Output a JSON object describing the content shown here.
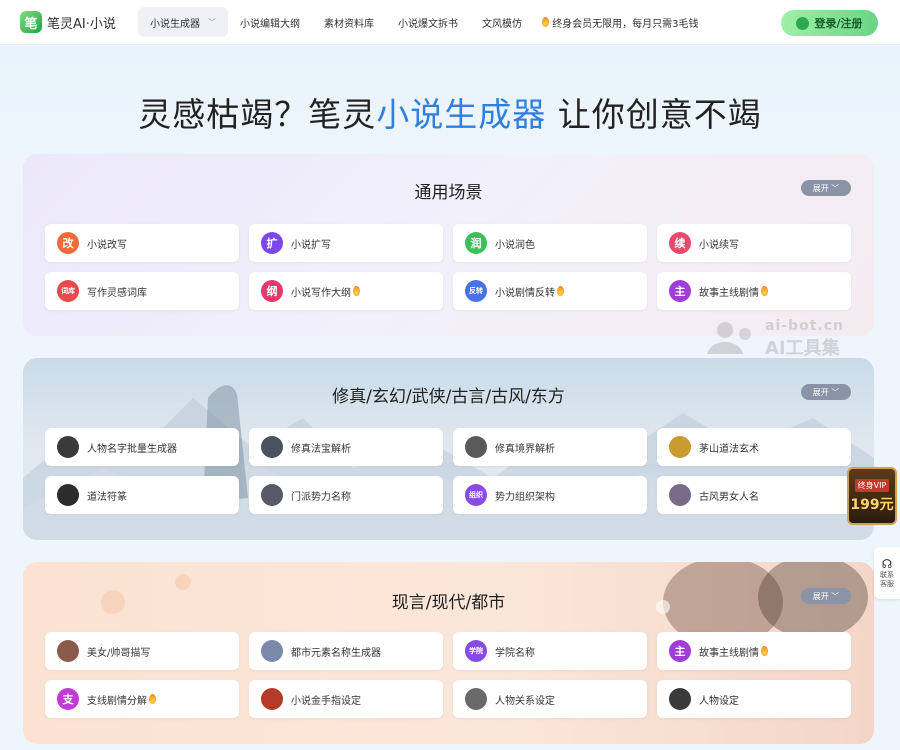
{
  "app": {
    "logo_mark": "笔",
    "logo_text": "笔灵AI·小说"
  },
  "nav": {
    "items": [
      {
        "label": "小说生成器",
        "active": true
      },
      {
        "label": "小说编辑大纲"
      },
      {
        "label": "素材资料库"
      },
      {
        "label": "小说爆文拆书"
      },
      {
        "label": "文风模仿"
      }
    ],
    "promo": "终身会员无限用，每月只需3毛钱",
    "login_label": "登录/注册"
  },
  "hero": {
    "title_before": "灵感枯竭？笔灵",
    "title_highlight": "小说生成器",
    "title_after": " 让你创意不竭"
  },
  "sections": [
    {
      "title": "通用场景",
      "expand": "展开",
      "cards": [
        {
          "label": "小说改写",
          "icon": "改",
          "icon_color": "#f06b3a",
          "fire": false
        },
        {
          "label": "小说扩写",
          "icon": "扩",
          "icon_color": "#7a48e8",
          "fire": false
        },
        {
          "label": "小说润色",
          "icon": "润",
          "icon_color": "#3cbf5c",
          "fire": false
        },
        {
          "label": "小说续写",
          "icon": "续",
          "icon_color": "#e84a6a",
          "fire": false
        },
        {
          "label": "写作灵感词库",
          "icon": "词库",
          "icon_color": "#e8494a",
          "fire": false
        },
        {
          "label": "小说写作大纲",
          "icon": "纲",
          "icon_color": "#e8376a",
          "fire": true
        },
        {
          "label": "小说剧情反转",
          "icon": "反转",
          "icon_color": "#4a72e8",
          "fire": true
        },
        {
          "label": "故事主线剧情",
          "icon": "主",
          "icon_color": "#a13cd6",
          "fire": true
        }
      ]
    },
    {
      "title": "修真/玄幻/武侠/古言/古风/东方",
      "expand": "展开",
      "cards": [
        {
          "label": "人物名字批量生成器",
          "icon": "",
          "icon_color": "#3a3a3a",
          "fire": false
        },
        {
          "label": "修真法宝解析",
          "icon": "",
          "icon_color": "#4a5260",
          "fire": false
        },
        {
          "label": "修真境界解析",
          "icon": "",
          "icon_color": "#5a5a5a",
          "fire": false
        },
        {
          "label": "茅山道法玄术",
          "icon": "",
          "icon_color": "#c99a2e",
          "fire": false
        },
        {
          "label": "道法符篆",
          "icon": "",
          "icon_color": "#2c2c2c",
          "fire": false
        },
        {
          "label": "门派势力名称",
          "icon": "",
          "icon_color": "#555a66",
          "fire": false
        },
        {
          "label": "势力组织架构",
          "icon": "组织",
          "icon_color": "#8a4ae8",
          "fire": false
        },
        {
          "label": "古风男女人名",
          "icon": "",
          "icon_color": "#7a6a8a",
          "fire": false
        }
      ]
    },
    {
      "title": "现言/现代/都市",
      "expand": "展开",
      "cards": [
        {
          "label": "美女/帅哥描写",
          "icon": "",
          "icon_color": "#8a5a4a",
          "fire": false
        },
        {
          "label": "都市元素名称生成器",
          "icon": "",
          "icon_color": "#7a8aa8",
          "fire": false
        },
        {
          "label": "学院名称",
          "icon": "学院",
          "icon_color": "#8a4ae8",
          "fire": false
        },
        {
          "label": "故事主线剧情",
          "icon": "主",
          "icon_color": "#a13cd6",
          "fire": true
        },
        {
          "label": "支线剧情分解",
          "icon": "支",
          "icon_color": "#c23ad6",
          "fire": true
        },
        {
          "label": "小说金手指设定",
          "icon": "",
          "icon_color": "#b53a2a",
          "fire": false
        },
        {
          "label": "人物关系设定",
          "icon": "",
          "icon_color": "#6a6a6a",
          "fire": false
        },
        {
          "label": "人物设定",
          "icon": "",
          "icon_color": "#3a3a3a",
          "fire": false
        }
      ]
    }
  ],
  "watermark": {
    "line1": "ai-bot.cn",
    "line2": "AI工具集"
  },
  "vip_badge": {
    "line1": "终身VIP",
    "line2": "199元"
  },
  "contact": {
    "label": "联系客服"
  }
}
